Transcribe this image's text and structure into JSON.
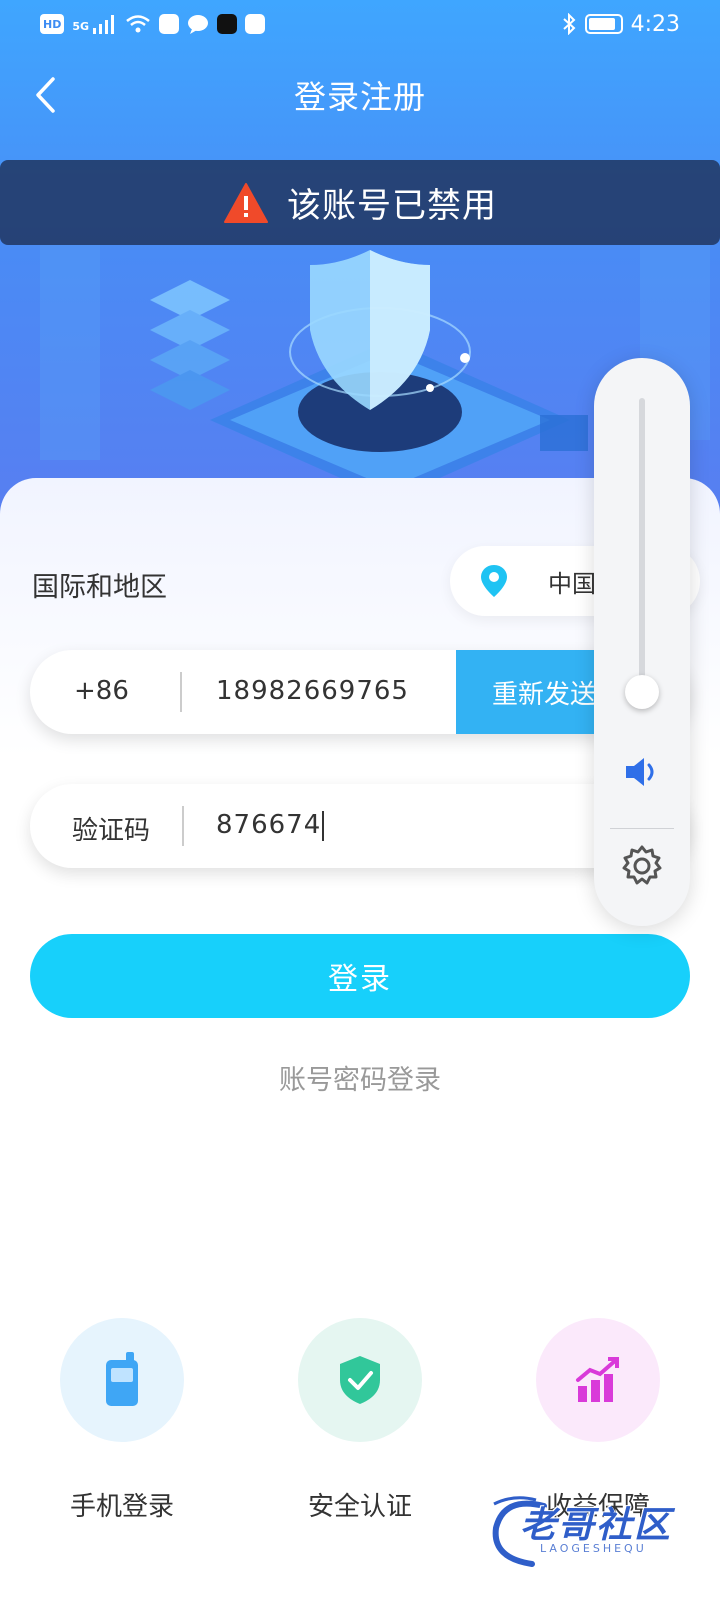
{
  "status_bar": {
    "left_indicators": [
      "HD",
      "5G"
    ],
    "time": "4:23",
    "icons": [
      "hd-badge-icon",
      "signal-icon",
      "wifi-icon",
      "app-notification-icon",
      "message-icon",
      "tiktok-icon",
      "app-notification-icon",
      "bluetooth-icon",
      "battery-icon"
    ]
  },
  "nav": {
    "title": "登录注册",
    "back_icon": "chevron-left-icon"
  },
  "banner": {
    "icon": "warning-icon",
    "text": "该账号已禁用"
  },
  "form": {
    "region_label": "国际和地区",
    "region_value": "中国",
    "region_icon": "location-pin-icon",
    "country_code": "+86",
    "phone_value": "18982669765",
    "resend_label": "重新发送",
    "code_label": "验证码",
    "code_value": "876674",
    "login_button": "登录",
    "password_login_link": "账号密码登录"
  },
  "features": [
    {
      "label": "手机登录",
      "icon": "phone-icon"
    },
    {
      "label": "安全认证",
      "icon": "shield-check-icon"
    },
    {
      "label": "收益保障",
      "icon": "growth-chart-icon"
    }
  ],
  "volume_panel": {
    "level": 0.02,
    "speaker_icon": "speaker-icon",
    "settings_icon": "gear-icon"
  },
  "watermark": {
    "text": "老哥社区",
    "subtext": "LAOGESHEQU"
  },
  "colors": {
    "hero_blue": "#3fa6ff",
    "resend_blue": "#33b2f3",
    "login_cyan": "#17d0fb",
    "warning_red": "#f04a2a",
    "feature_phone_bg": "#e6f4fd",
    "feature_shield_bg": "#e5f6f1",
    "feature_chart_bg": "#fbe9fb"
  }
}
